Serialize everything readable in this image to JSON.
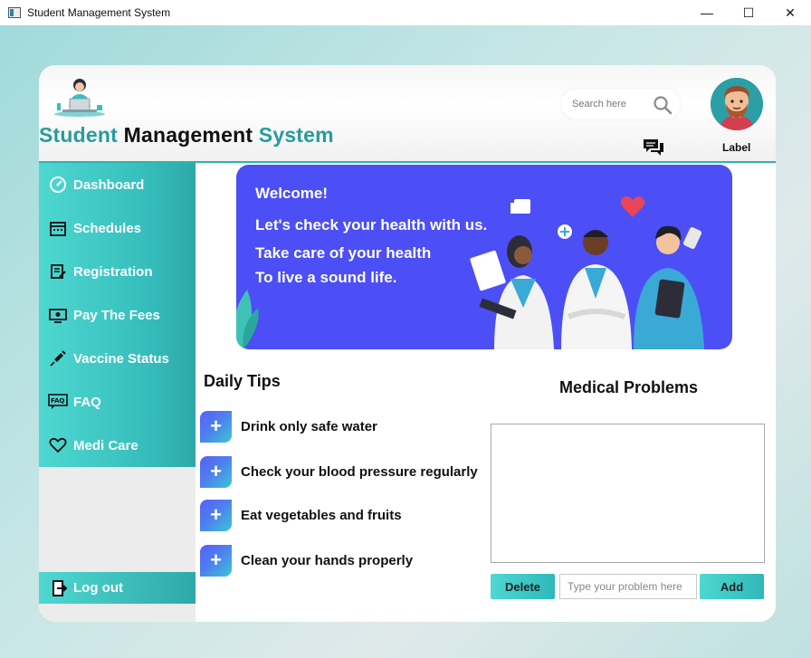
{
  "window": {
    "title": "Student Management System",
    "controls": {
      "minimize": "—",
      "maximize": "☐",
      "close": "✕"
    }
  },
  "header": {
    "brand_part1": "Student",
    "brand_part2": "Management",
    "brand_part3": "System",
    "search_placeholder": "Search here",
    "profile_label": "Label"
  },
  "sidebar": {
    "items": [
      {
        "label": "Dashboard",
        "icon": "speedometer-icon"
      },
      {
        "label": "Schedules",
        "icon": "calendar-icon"
      },
      {
        "label": "Registration",
        "icon": "form-icon"
      },
      {
        "label": "Pay The Fees",
        "icon": "money-icon"
      },
      {
        "label": "Vaccine Status",
        "icon": "syringe-icon"
      },
      {
        "label": "FAQ",
        "icon": "faq-icon"
      },
      {
        "label": "Medi Care",
        "icon": "heart-icon"
      }
    ],
    "logout_label": "Log out"
  },
  "banner": {
    "welcome": "Welcome!",
    "line1": "Let's check your health with us.",
    "line2": "Take care of your health",
    "line3": "To live a sound life."
  },
  "daily_tips": {
    "title": "Daily Tips",
    "items": [
      "Drink only safe water",
      "Check your blood pressure regularly",
      "Eat vegetables and fruits",
      "Clean your hands properly"
    ]
  },
  "medical_problems": {
    "title": "Medical Problems",
    "delete_label": "Delete",
    "input_placeholder": "Type your problem here",
    "add_label": "Add"
  },
  "colors": {
    "accent_teal": "#2cb3b3",
    "banner_blue": "#4b4ff5"
  }
}
